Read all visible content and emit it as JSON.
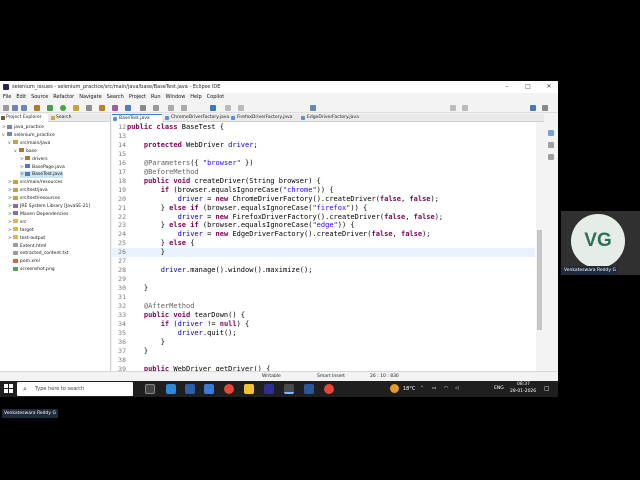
{
  "window": {
    "title": "selenium_issues - selenium_practice/src/main/java/base/BaseTest.java - Eclipse IDE",
    "controls": [
      "–",
      "□",
      "✕"
    ]
  },
  "menu": [
    "File",
    "Edit",
    "Source",
    "Refactor",
    "Navigate",
    "Search",
    "Project",
    "Run",
    "Window",
    "Help",
    "Copilot"
  ],
  "left_panel": {
    "tabs": [
      "Project Explorer",
      "Search"
    ],
    "tree": [
      {
        "label": "java_practice",
        "indent": 0,
        "arrow": ">",
        "icon": "project",
        "selected": false
      },
      {
        "label": "selenium_practice",
        "indent": 0,
        "arrow": "v",
        "icon": "project",
        "selected": false
      },
      {
        "label": "src/main/java",
        "indent": 1,
        "arrow": "v",
        "icon": "srcfolder",
        "selected": false
      },
      {
        "label": "base",
        "indent": 2,
        "arrow": "v",
        "icon": "package",
        "selected": false
      },
      {
        "label": "drivers",
        "indent": 3,
        "arrow": ">",
        "icon": "package",
        "selected": false
      },
      {
        "label": "BasePage.java",
        "indent": 3,
        "arrow": ">",
        "icon": "java",
        "selected": false
      },
      {
        "label": "BaseTest.java",
        "indent": 3,
        "arrow": ">",
        "icon": "java",
        "selected": true
      },
      {
        "label": "src/main/resources",
        "indent": 1,
        "arrow": ">",
        "icon": "srcfolder",
        "selected": false
      },
      {
        "label": "src/test/java",
        "indent": 1,
        "arrow": ">",
        "icon": "srcfolder",
        "selected": false
      },
      {
        "label": "src/test/resources",
        "indent": 1,
        "arrow": ">",
        "icon": "srcfolder",
        "selected": false
      },
      {
        "label": "JRE System Library [JavaSE-21]",
        "indent": 1,
        "arrow": ">",
        "icon": "library",
        "selected": false
      },
      {
        "label": "Maven Dependencies",
        "indent": 1,
        "arrow": ">",
        "icon": "library",
        "selected": false
      },
      {
        "label": "src",
        "indent": 1,
        "arrow": ">",
        "icon": "folder",
        "selected": false
      },
      {
        "label": "target",
        "indent": 1,
        "arrow": ">",
        "icon": "folder",
        "selected": false
      },
      {
        "label": "test-output",
        "indent": 1,
        "arrow": ">",
        "icon": "folder",
        "selected": false
      },
      {
        "label": "Extent.html",
        "indent": 1,
        "arrow": "",
        "icon": "file",
        "selected": false
      },
      {
        "label": "extracted_content.txt",
        "indent": 1,
        "arrow": "",
        "icon": "file",
        "selected": false
      },
      {
        "label": "pom.xml",
        "indent": 1,
        "arrow": "",
        "icon": "xml",
        "selected": false
      },
      {
        "label": "screenshot.png",
        "indent": 1,
        "arrow": "",
        "icon": "image",
        "selected": false
      }
    ]
  },
  "editor_tabs": [
    {
      "label": "BaseTest.java",
      "active": true
    },
    {
      "label": "ChromeDriverFactory.java",
      "active": false
    },
    {
      "label": "FirefoxDriverFactory.java",
      "active": false
    },
    {
      "label": "EdgeDriverFactory.java",
      "active": false
    }
  ],
  "code": [
    {
      "n": "12",
      "html": "<span class='kw'>public class</span> BaseTest {"
    },
    {
      "n": "13",
      "html": ""
    },
    {
      "n": "14",
      "html": "    <span class='kw'>protected</span> WebDriver <span class='fld'>driver</span>;"
    },
    {
      "n": "15",
      "html": ""
    },
    {
      "n": "16",
      "html": "    <span class='an'>@Parameters</span>({ <span class='str'>\"browser\"</span> })"
    },
    {
      "n": "17",
      "html": "    <span class='an'>@BeforeMethod</span>"
    },
    {
      "n": "18",
      "html": "    <span class='kw'>public void</span> createDriver(String browser) {"
    },
    {
      "n": "19",
      "html": "        <span class='kw'>if</span> (browser.equalsIgnoreCase(<span class='str'>\"chrome\"</span>)) {"
    },
    {
      "n": "20",
      "html": "            <span class='fld'>driver</span> = <span class='kw'>new</span> ChromeDriverFactory().createDriver(<span class='kw'>false</span>, <span class='kw'>false</span>);"
    },
    {
      "n": "21",
      "html": "        } <span class='kw'>else if</span> (browser.equalsIgnoreCase(<span class='str'>\"firefox\"</span>)) {"
    },
    {
      "n": "22",
      "html": "            <span class='fld'>driver</span> = <span class='kw'>new</span> FirefoxDriverFactory().createDriver(<span class='kw'>false</span>, <span class='kw'>false</span>);"
    },
    {
      "n": "23",
      "html": "        } <span class='kw'>else if</span> (browser.equalsIgnoreCase(<span class='str'>\"edge\"</span>)) {"
    },
    {
      "n": "24",
      "html": "            <span class='fld'>driver</span> = <span class='kw'>new</span> EdgeDriverFactory().createDriver(<span class='kw'>false</span>, <span class='kw'>false</span>);"
    },
    {
      "n": "25",
      "html": "        } <span class='kw'>else</span> {"
    },
    {
      "n": "26",
      "html": "        }",
      "current": true
    },
    {
      "n": "27",
      "html": ""
    },
    {
      "n": "28",
      "html": "        <span class='fld'>driver</span>.manage().window().maximize();"
    },
    {
      "n": "29",
      "html": ""
    },
    {
      "n": "30",
      "html": "    }"
    },
    {
      "n": "31",
      "html": ""
    },
    {
      "n": "32",
      "html": "    <span class='an'>@AfterMethod</span>"
    },
    {
      "n": "33",
      "html": "    <span class='kw'>public void</span> tearDown() {"
    },
    {
      "n": "34",
      "html": "        <span class='kw'>if</span> (<span class='fld'>driver</span> != <span class='kw'>null</span>) {"
    },
    {
      "n": "35",
      "html": "            <span class='fld'>driver</span>.quit();"
    },
    {
      "n": "36",
      "html": "        }"
    },
    {
      "n": "37",
      "html": "    }"
    },
    {
      "n": "38",
      "html": ""
    },
    {
      "n": "39",
      "html": "    <span class='kw'>public</span> WebDriver getDriver() {"
    }
  ],
  "status": {
    "writable": "Writable",
    "insert_mode": "Smart Insert",
    "position": "26 : 10 : 830"
  },
  "taskbar": {
    "search_placeholder": "Type here to search",
    "weather": "18°C",
    "lang": "ENG",
    "time": "08:37",
    "date": "28-01-2026"
  },
  "participant": {
    "initials": "VG",
    "name": "Venkateswara Reddy G",
    "avatar_bg": "#e6ede6",
    "initials_color": "#2f6f57"
  },
  "self_label": "Venkateswara Reddy G",
  "colors": {
    "keyword": "#7f0055",
    "string": "#2a00ff",
    "annotation": "#646464",
    "field": "#0000c0"
  }
}
